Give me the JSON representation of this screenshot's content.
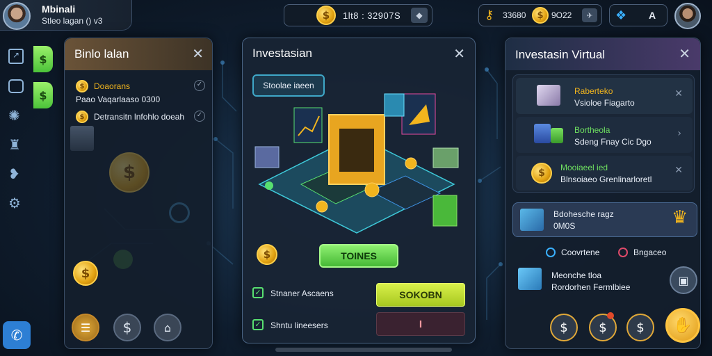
{
  "player": {
    "name": "Mbinali",
    "subtitle": "Stleo lagan () v3"
  },
  "topbar": {
    "balance_value": "1lt8 : 32907S",
    "gold_value": "33680",
    "gems_value": "9O22",
    "help_label": "A"
  },
  "left_panel": {
    "title": "Binlo lalan",
    "item1_title": "Doaorans",
    "item1_sub": "Paao Vaqarlaaso 0300",
    "item2_title": "Detransitn lnfohlo doeah"
  },
  "center_panel": {
    "title": "Investasian",
    "tag_label": "Stoolae iaeen",
    "primary_button": "TOINES",
    "checkbox1_label": "Stnaner Ascaens",
    "checkbox2_label": "Shntu lineesers",
    "action_button": "SOKOBN",
    "counter_value": "I"
  },
  "right_panel": {
    "title": "Investasin Virtual",
    "items": [
      {
        "title": "Raberteko",
        "sub": "Vsioloe Fiagarto"
      },
      {
        "title": "Bortheola",
        "sub": "Sdeng Fnay Cic Dgo"
      },
      {
        "title": "Mooiaeel ied",
        "sub": "Blnsoiaeo Grenlinarloretl"
      }
    ],
    "featured_title": "Bdohesche ragz",
    "featured_value": "0M0S",
    "link1": "Coovrtene",
    "link2": "Bngaceo",
    "footer_title": "Meonche tloa",
    "footer_sub": "Rordorhen Fermlbiee"
  },
  "colors": {
    "accent_green": "#6fe060",
    "gold": "#f2b51e",
    "panel_border": "#3a4d66",
    "lime": "#c8e82a"
  },
  "icons": [
    "avatar",
    "chart-icon",
    "camera-icon",
    "settings-icon",
    "users-icon",
    "chat-icon",
    "gear-icon",
    "phone-icon",
    "dollar-icon",
    "wallet-icon",
    "bank-icon",
    "close-icon",
    "check-icon",
    "padlock-icon"
  ]
}
